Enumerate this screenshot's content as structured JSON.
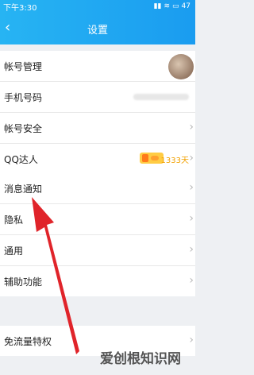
{
  "status_bar": {
    "time": "下午3:30",
    "battery": "47"
  },
  "nav": {
    "title": "设置"
  },
  "group1": [
    {
      "label": "帐号管理"
    },
    {
      "label": "手机号码"
    },
    {
      "label": "帐号安全"
    },
    {
      "label": "QQ达人",
      "days": "1333天"
    }
  ],
  "group2": [
    {
      "label": "消息通知"
    },
    {
      "label": "隐私"
    },
    {
      "label": "通用"
    },
    {
      "label": "辅助功能"
    }
  ],
  "group3": [
    {
      "label": "免流量特权"
    }
  ],
  "watermark": "爱创根知识网",
  "colors": {
    "header": "#1a9cf0",
    "arrow": "#e0242a",
    "qq_days": "#f2a100"
  }
}
